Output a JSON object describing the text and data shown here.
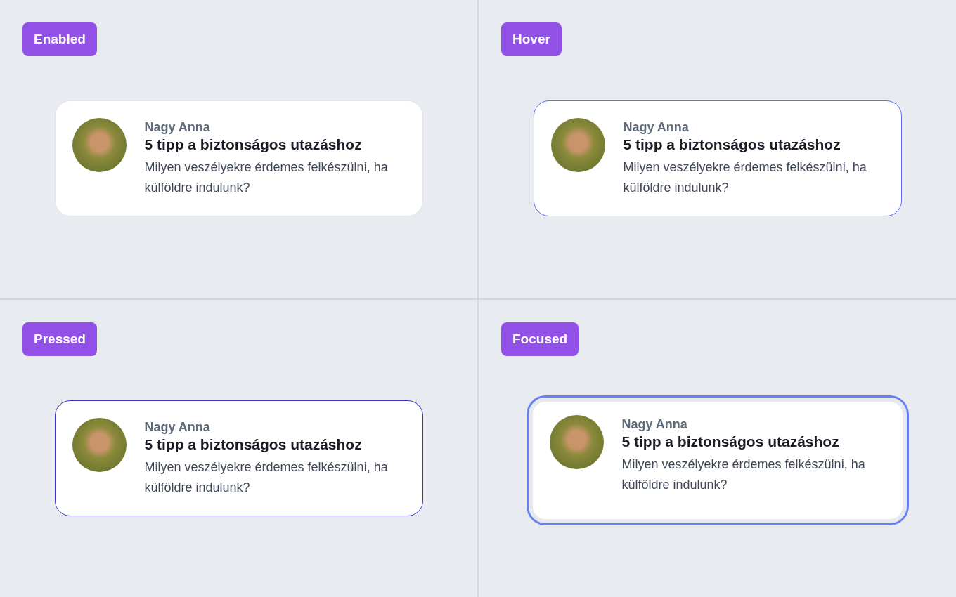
{
  "panels": [
    {
      "label": "Enabled",
      "kind": "enabled",
      "card": {
        "author": "Nagy Anna",
        "title": "5 tipp a biztonságos utazáshoz",
        "description": "Milyen veszélyekre érdemes felkészülni, ha külföldre indulunk?"
      }
    },
    {
      "label": "Hover",
      "kind": "hover",
      "card": {
        "author": "Nagy Anna",
        "title": "5 tipp a biztonságos utazáshoz",
        "description": "Milyen veszélyekre érdemes felkészülni, ha külföldre indulunk?"
      }
    },
    {
      "label": "Pressed",
      "kind": "pressed",
      "card": {
        "author": "Nagy Anna",
        "title": "5 tipp a biztonságos utazáshoz",
        "description": "Milyen veszélyekre érdemes felkészülni, ha külföldre indulunk?"
      }
    },
    {
      "label": "Focused",
      "kind": "focused",
      "card": {
        "author": "Nagy Anna",
        "title": "5 tipp a biztonságos utazáshoz",
        "description": "Milyen veszélyekre érdemes felkészülni, ha külföldre indulunk?"
      }
    }
  ]
}
